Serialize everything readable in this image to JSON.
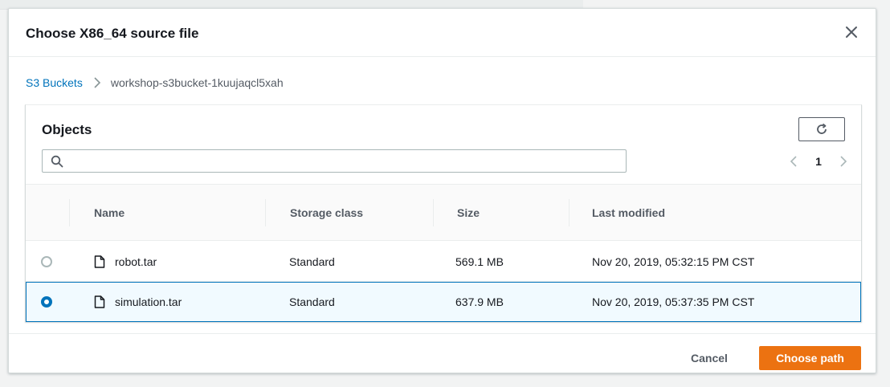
{
  "dialog": {
    "title": "Choose X86_64 source file"
  },
  "breadcrumb": {
    "root": "S3 Buckets",
    "current": "workshop-s3bucket-1kuujaqcl5xah"
  },
  "objects": {
    "title": "Objects",
    "search": {
      "value": "",
      "placeholder": ""
    },
    "pagination": {
      "current_page": "1"
    },
    "columns": [
      "Name",
      "Storage class",
      "Size",
      "Last modified"
    ],
    "rows": [
      {
        "name": "robot.tar",
        "storage_class": "Standard",
        "size": "569.1 MB",
        "last_modified": "Nov 20, 2019, 05:32:15 PM CST",
        "selected": false
      },
      {
        "name": "simulation.tar",
        "storage_class": "Standard",
        "size": "637.9 MB",
        "last_modified": "Nov 20, 2019, 05:37:35 PM CST",
        "selected": true
      }
    ]
  },
  "footer": {
    "cancel_label": "Cancel",
    "primary_label": "Choose path"
  },
  "icons": {
    "close": "close-icon",
    "breadcrumb_separator": "chevron-right-icon",
    "refresh": "refresh-icon",
    "search": "search-icon",
    "page_prev": "chevron-left-icon",
    "page_next": "chevron-right-icon",
    "file": "file-icon"
  },
  "colors": {
    "link": "#0073bb",
    "primary_button": "#ec7211",
    "selected_row_bg": "#f1faff",
    "selected_row_border": "#0073bb"
  }
}
